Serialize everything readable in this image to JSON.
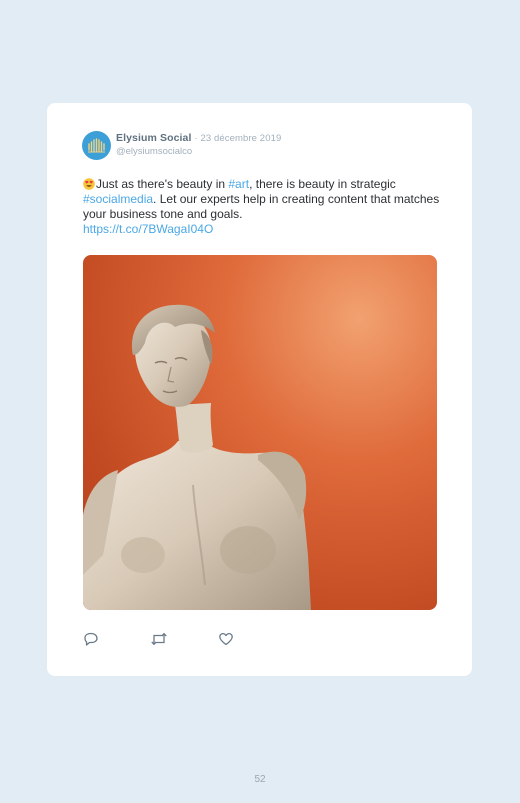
{
  "tweet": {
    "account_name": "Elysium Social",
    "date": "· 23 décembre 2019",
    "handle": "@elysiumsocialco",
    "emoji": "😍",
    "text_1": "Just as there's beauty in ",
    "hashtag_art": "#art",
    "text_2": ", there is beauty in strategic ",
    "hashtag_socialmedia": "#socialmedia",
    "text_3": ". Let our experts help in creating content that matches your business tone and goals.",
    "url": "https://t.co/7BWagaI04O",
    "image_alt": "Classical marble statue against an orange background"
  },
  "actions": [
    {
      "icon": "reply-icon"
    },
    {
      "icon": "retweet-icon"
    },
    {
      "icon": "like-icon"
    }
  ],
  "page_number": "52",
  "colors": {
    "background": "#e1ecf5",
    "card": "#ffffff",
    "link": "#4aa8e6",
    "avatar": "#3d9fd8"
  }
}
